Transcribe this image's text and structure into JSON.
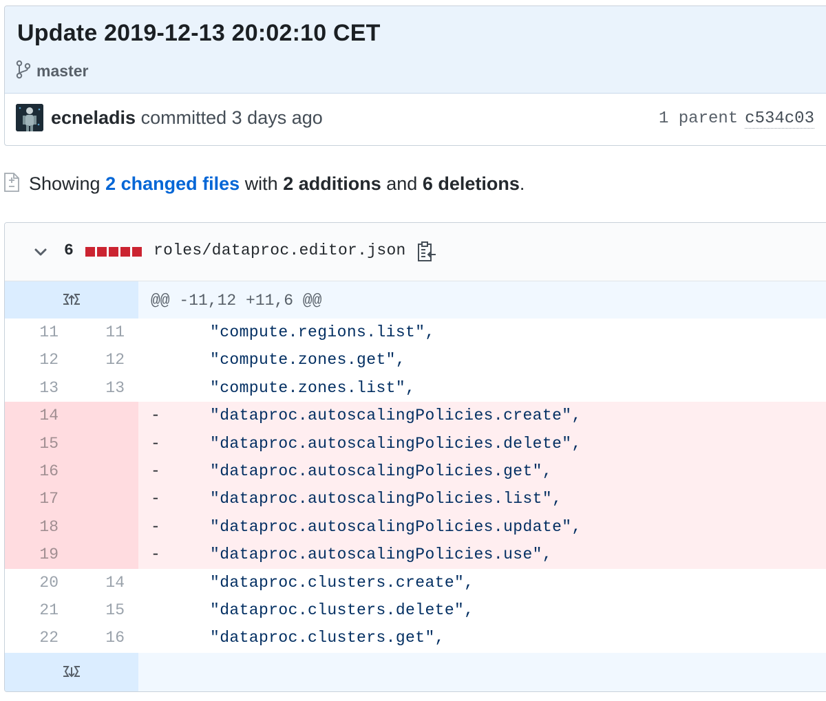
{
  "commit": {
    "title": "Update 2019-12-13 20:02:10 CET",
    "branch": "master",
    "author": "ecneladis",
    "action": "committed",
    "time": "3 days ago",
    "parent_label": "1 parent",
    "parent_sha": "c534c03",
    "icons": {
      "branch": "git-branch-icon",
      "avatar": "avatar"
    }
  },
  "summary": {
    "prefix": "Showing",
    "changed_files": "2 changed files",
    "with": "with",
    "additions": "2 additions",
    "and": "and",
    "deletions": "6 deletions",
    "end": ".",
    "icon": "file-diff-icon"
  },
  "file": {
    "change_count": "6",
    "diffstat": {
      "deleted_blocks": 5,
      "color": "#cb2431"
    },
    "name": "roles/dataproc.editor.json",
    "hunk_header": "@@ -11,12 +11,6 @@",
    "icons": {
      "collapse": "chevron-down-icon",
      "copy": "copy-path-icon",
      "expand_up": "expand-up-icon",
      "expand_down": "expand-down-icon"
    },
    "lines": [
      {
        "old": "11",
        "new": "11",
        "sign": "",
        "type": "context",
        "code": "\"compute.regions.list\","
      },
      {
        "old": "12",
        "new": "12",
        "sign": "",
        "type": "context",
        "code": "\"compute.zones.get\","
      },
      {
        "old": "13",
        "new": "13",
        "sign": "",
        "type": "context",
        "code": "\"compute.zones.list\","
      },
      {
        "old": "14",
        "new": "",
        "sign": "-",
        "type": "deletion",
        "code": "\"dataproc.autoscalingPolicies.create\","
      },
      {
        "old": "15",
        "new": "",
        "sign": "-",
        "type": "deletion",
        "code": "\"dataproc.autoscalingPolicies.delete\","
      },
      {
        "old": "16",
        "new": "",
        "sign": "-",
        "type": "deletion",
        "code": "\"dataproc.autoscalingPolicies.get\","
      },
      {
        "old": "17",
        "new": "",
        "sign": "-",
        "type": "deletion",
        "code": "\"dataproc.autoscalingPolicies.list\","
      },
      {
        "old": "18",
        "new": "",
        "sign": "-",
        "type": "deletion",
        "code": "\"dataproc.autoscalingPolicies.update\","
      },
      {
        "old": "19",
        "new": "",
        "sign": "-",
        "type": "deletion",
        "code": "\"dataproc.autoscalingPolicies.use\","
      },
      {
        "old": "20",
        "new": "14",
        "sign": "",
        "type": "context",
        "code": "\"dataproc.clusters.create\","
      },
      {
        "old": "21",
        "new": "15",
        "sign": "",
        "type": "context",
        "code": "\"dataproc.clusters.delete\","
      },
      {
        "old": "22",
        "new": "16",
        "sign": "",
        "type": "context",
        "code": "\"dataproc.clusters.get\","
      }
    ]
  },
  "colors": {
    "header_bg": "#eaf3fc",
    "link": "#0366d6",
    "deletion_bg": "#ffeef0",
    "deletion_gutter": "#ffdce0",
    "hunk_bg": "#f1f8ff",
    "code_text": "#032f62"
  }
}
